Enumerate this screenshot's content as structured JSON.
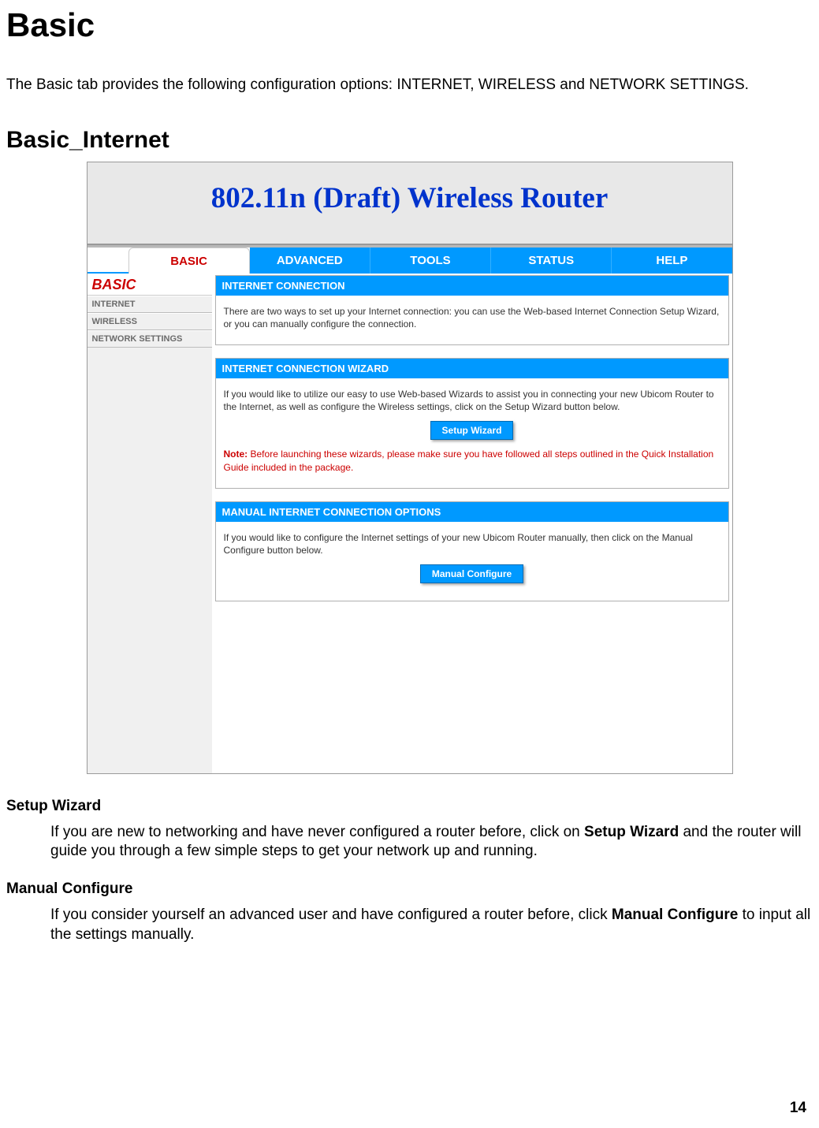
{
  "doc": {
    "h1": "Basic",
    "intro": "The Basic tab provides the following configuration options: INTERNET, WIRELESS and NETWORK SETTINGS.",
    "h2": "Basic_Internet",
    "setup_h": "Setup Wizard",
    "setup_p_a": "If you are new to networking and have never configured a router before, click on ",
    "setup_p_b": "Setup Wizard",
    "setup_p_c": " and the router will guide you through a few simple steps to get your network up and running.",
    "manual_h": "Manual Configure",
    "manual_p_a": "If you consider yourself an advanced user and have configured a router before, click ",
    "manual_p_b": "Manual Configure",
    "manual_p_c": " to input all the settings manually.",
    "page_number": "14"
  },
  "router": {
    "banner": "802.11n (Draft) Wireless Router",
    "tabs": {
      "basic": "BASIC",
      "advanced": "ADVANCED",
      "tools": "TOOLS",
      "status": "STATUS",
      "help": "HELP"
    },
    "sidebar": {
      "title": "BASIC",
      "items": {
        "internet": "INTERNET",
        "wireless": "WIRELESS",
        "network": "NETWORK SETTINGS"
      }
    },
    "panels": {
      "p1": {
        "head": "INTERNET CONNECTION",
        "body": "There are two ways to set up your Internet connection: you can use the Web-based Internet Connection Setup Wizard, or you can manually configure the connection."
      },
      "p2": {
        "head": "INTERNET CONNECTION WIZARD",
        "body": "If you would like to utilize our easy to use Web-based Wizards to assist you in connecting your new Ubicom Router to the Internet, as well as configure the Wireless settings, click on the Setup Wizard button below.",
        "button": "Setup Wizard",
        "note_label": "Note:",
        "note_text": " Before launching these wizards, please make sure you have followed all steps outlined in the Quick Installation Guide included in the package."
      },
      "p3": {
        "head": "MANUAL INTERNET CONNECTION OPTIONS",
        "body": "If you would like to configure the Internet settings of your new Ubicom Router manually, then click on the Manual Configure button below.",
        "button": "Manual Configure"
      }
    }
  }
}
